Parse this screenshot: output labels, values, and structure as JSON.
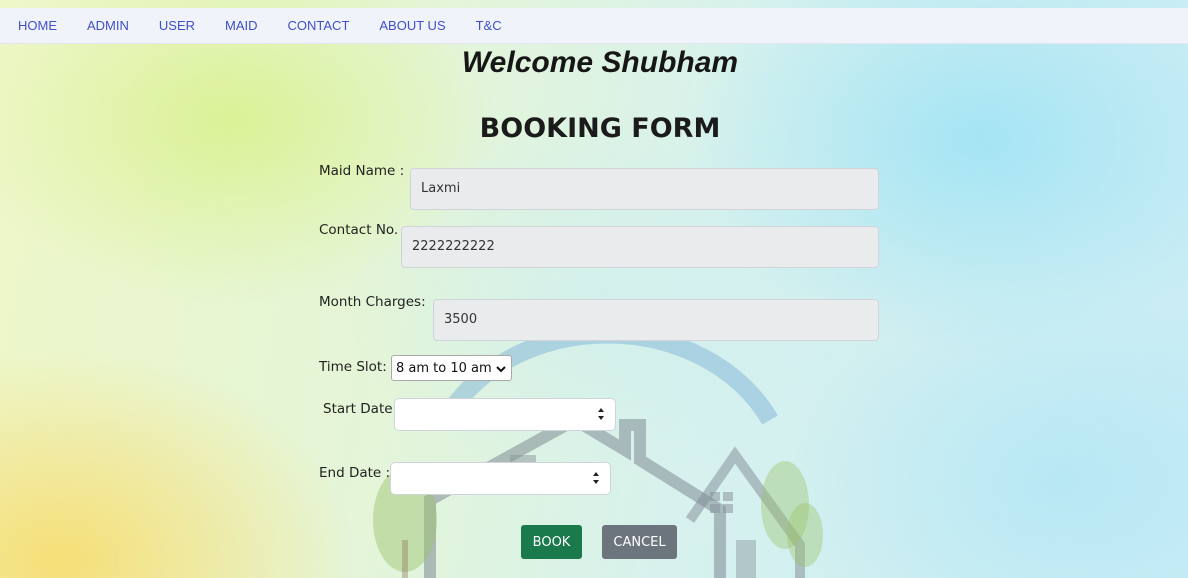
{
  "nav": {
    "items": [
      {
        "label": "HOME"
      },
      {
        "label": "ADMIN"
      },
      {
        "label": "USER"
      },
      {
        "label": "MAID"
      },
      {
        "label": "CONTACT"
      },
      {
        "label": "ABOUT US"
      },
      {
        "label": "T&C"
      }
    ]
  },
  "header": {
    "welcome": "Welcome Shubham",
    "title": "BOOKING FORM"
  },
  "form": {
    "maid_name": {
      "label": "Maid Name :",
      "value": "Laxmi"
    },
    "contact": {
      "label": "Contact No. :",
      "value": "2222222222"
    },
    "charges": {
      "label": "Month Charges:",
      "value": "3500"
    },
    "time_slot": {
      "label": "Time Slot:",
      "selected": "8 am to 10 am"
    },
    "start_date": {
      "label": "Start Date :",
      "value": ""
    },
    "end_date": {
      "label": "End Date :",
      "value": ""
    }
  },
  "buttons": {
    "book": "BOOK",
    "cancel": "CANCEL"
  },
  "colors": {
    "nav_link": "#3f4fc8",
    "book_button": "#1a7a4c",
    "cancel_button": "#6c757d",
    "input_readonly_bg": "#e9ebed"
  }
}
